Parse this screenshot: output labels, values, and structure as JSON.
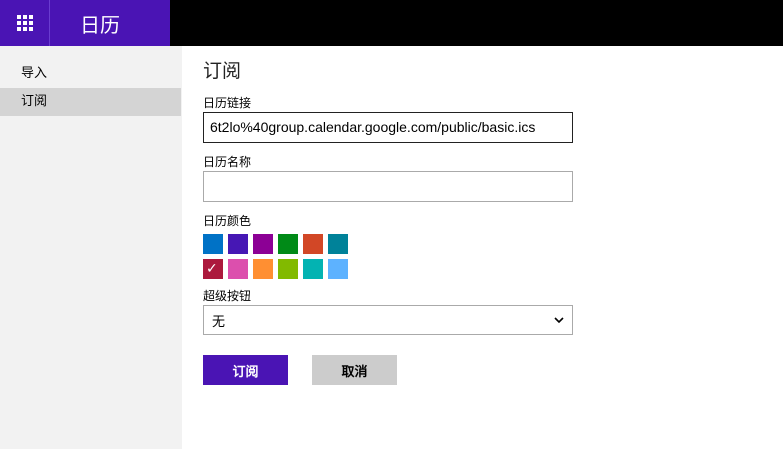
{
  "header": {
    "app_title": "日历",
    "brand_color": "#4a14b4",
    "waffle_icon": "waffle-icon"
  },
  "sidebar": {
    "items": [
      {
        "label": "导入",
        "active": false
      },
      {
        "label": "订阅",
        "active": true
      }
    ]
  },
  "main": {
    "title": "订阅",
    "calendar_link": {
      "label": "日历链接",
      "value": "6t2lo%40group.calendar.google.com/public/basic.ics"
    },
    "calendar_name": {
      "label": "日历名称",
      "value": ""
    },
    "calendar_color": {
      "label": "日历颜色",
      "colors": [
        "#0072c6",
        "#4617b4",
        "#8c0095",
        "#008a17",
        "#d24726",
        "#008299",
        "#ac193d",
        "#dc4fad",
        "#ff8f32",
        "#82ba00",
        "#03b3b2",
        "#5db2ff"
      ],
      "selected_index": 6
    },
    "charm_button": {
      "label": "超级按钮",
      "selected": "无"
    },
    "subscribe_label": "订阅",
    "cancel_label": "取消"
  }
}
